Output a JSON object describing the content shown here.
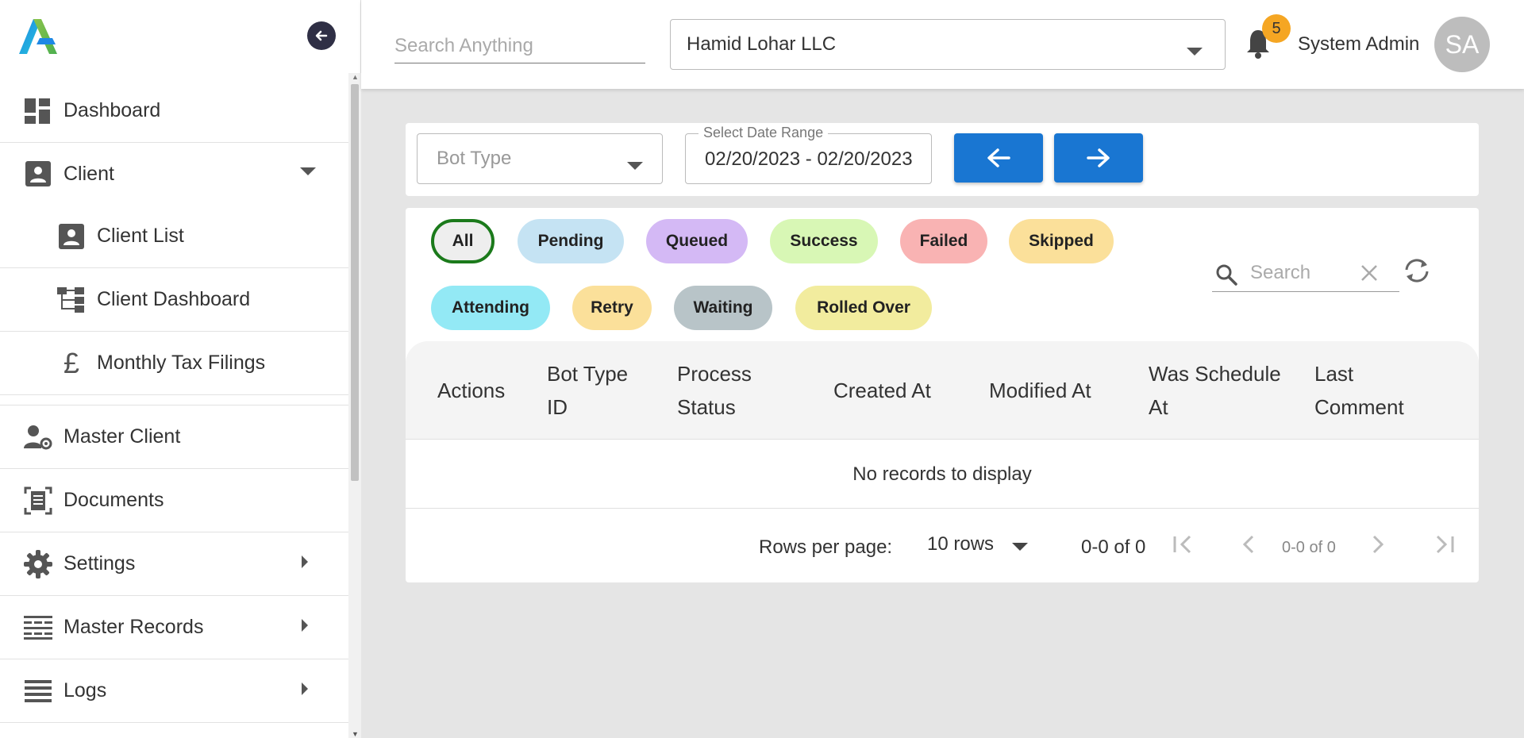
{
  "sidebar": {
    "items": [
      {
        "label": "Dashboard",
        "icon": "dashboard-icon"
      },
      {
        "label": "Client",
        "icon": "person-box-icon"
      },
      {
        "label": "Client List",
        "icon": "person-box-icon"
      },
      {
        "label": "Client Dashboard",
        "icon": "hierarchy-icon"
      },
      {
        "label": "Monthly Tax Filings",
        "icon": "pound-icon"
      },
      {
        "label": "Master Client",
        "icon": "user-gear-icon"
      },
      {
        "label": "Documents",
        "icon": "document-scan-icon"
      },
      {
        "label": "Settings",
        "icon": "gear-icon"
      },
      {
        "label": "Master Records",
        "icon": "table-icon"
      },
      {
        "label": "Logs",
        "icon": "list-icon"
      }
    ]
  },
  "topbar": {
    "search_placeholder": "Search Anything",
    "company": "Hamid Lohar LLC",
    "notification_count": "5",
    "user_name": "System Admin",
    "avatar_initials": "SA"
  },
  "filters": {
    "bot_type_placeholder": "Bot Type",
    "date_range_label": "Select Date Range",
    "date_range_value": "02/20/2023 - 02/20/2023"
  },
  "status_chips": [
    {
      "label": "All",
      "color": "#eeeeee"
    },
    {
      "label": "Pending",
      "color": "#c5e3f3"
    },
    {
      "label": "Queued",
      "color": "#d4b9f5"
    },
    {
      "label": "Success",
      "color": "#d8f7b5"
    },
    {
      "label": "Failed",
      "color": "#f9b3b3"
    },
    {
      "label": "Skipped",
      "color": "#fbe09a"
    },
    {
      "label": "Attending",
      "color": "#93e9f5"
    },
    {
      "label": "Retry",
      "color": "#fbe09a"
    },
    {
      "label": "Waiting",
      "color": "#b8c4c8"
    },
    {
      "label": "Rolled Over",
      "color": "#f2ec9e"
    }
  ],
  "table": {
    "search_placeholder": "Search",
    "columns": [
      "Actions",
      "Bot Type ID",
      "Process Status",
      "Created At",
      "Modified At",
      "Was Schedule At",
      "Last Comment"
    ],
    "empty_message": "No records to display"
  },
  "pagination": {
    "rows_per_page_label": "Rows per page:",
    "rows_per_page_value": "10 rows",
    "count": "0-0 of 0",
    "mini_count": "0-0 of 0"
  },
  "colors": {
    "accent": "#1976d2",
    "badge": "#f5a623",
    "all_chip_border": "#1b7a1b"
  }
}
